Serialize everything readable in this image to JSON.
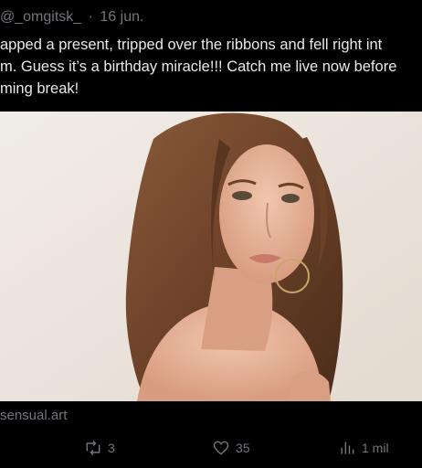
{
  "tweet": {
    "handle": "@_omgitsk_",
    "separator": "·",
    "date": "16 jun.",
    "text_lines": [
      "apped a present, tripped over the ribbons and fell right int",
      "m. Guess it’s a birthday miracle!!! Catch me live now before",
      "ming break!"
    ],
    "media_alt": "Portrait of a woman with long brown hair and hoop earrings looking over her bare shoulder",
    "source": "sensual.art"
  },
  "actions": {
    "retweet": {
      "icon": "retweet-icon",
      "count": "3"
    },
    "like": {
      "icon": "heart-icon",
      "count": "35"
    },
    "views": {
      "icon": "bar-chart-icon",
      "count": "1 mil"
    }
  },
  "colors": {
    "background": "#000000",
    "text": "#e7e9ea",
    "muted": "#71767b"
  }
}
